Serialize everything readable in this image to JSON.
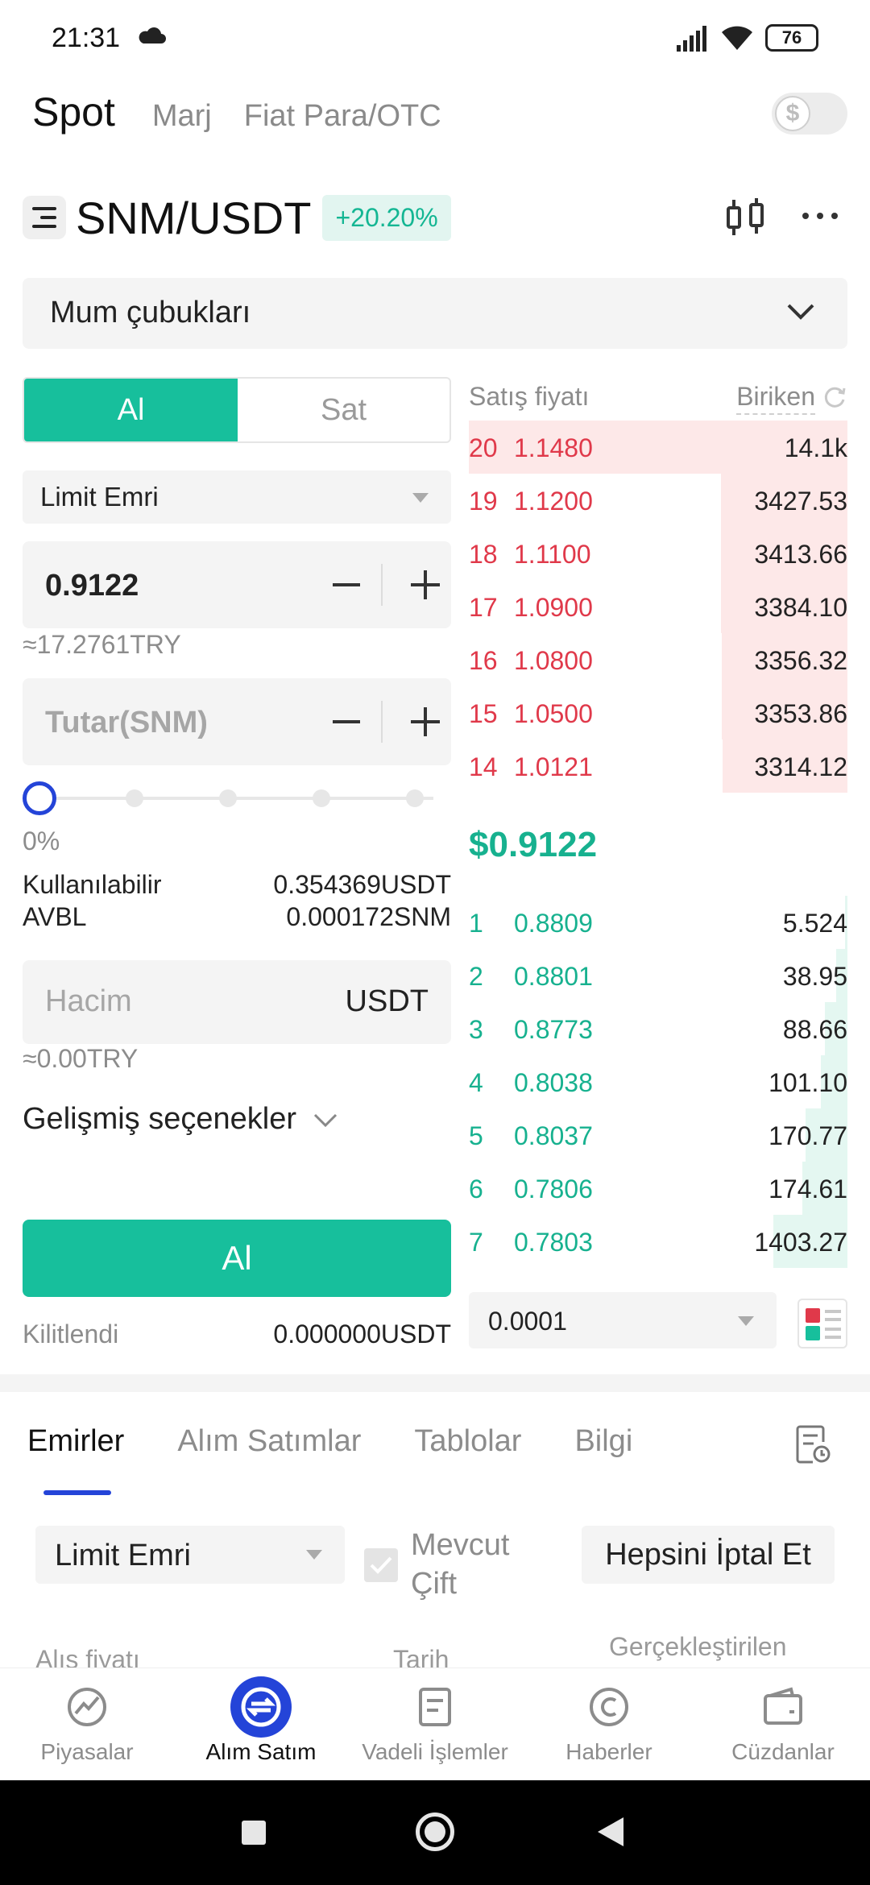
{
  "status_bar": {
    "time": "21:31",
    "battery": "76"
  },
  "top_tabs": {
    "spot": "Spot",
    "margin": "Marj",
    "fiat": "Fiat Para/OTC"
  },
  "pair": {
    "symbol": "SNM/USDT",
    "change": "+20.20%"
  },
  "chart_selector": {
    "label": "Mum çubukları"
  },
  "trade_form": {
    "buy_tab": "Al",
    "sell_tab": "Sat",
    "order_type": "Limit Emri",
    "price_value": "0.9122",
    "price_try": "≈17.2761TRY",
    "amount_placeholder": "Tutar(SNM)",
    "slider_percent": "0%",
    "available_label": "Kullanılabilir",
    "available_value": "0.354369USDT",
    "avbl_label": "AVBL",
    "avbl_value": "0.000172SNM",
    "volume_placeholder": "Hacim",
    "volume_unit": "USDT",
    "volume_try": "≈0.00TRY",
    "advanced_label": "Gelişmiş seçenekler",
    "buy_button": "Al",
    "locked_label": "Kilitlendi",
    "locked_value": "0.000000USDT"
  },
  "order_book": {
    "price_header": "Satış fiyatı",
    "cumulative_header": "Biriken",
    "last_price": "$0.9122",
    "precision": "0.0001",
    "asks": [
      {
        "level": "20",
        "price": "1.1480",
        "qty": "14.1k",
        "depth": 1.0
      },
      {
        "level": "19",
        "price": "1.1200",
        "qty": "3427.53",
        "depth": 0.335
      },
      {
        "level": "18",
        "price": "1.1100",
        "qty": "3413.66",
        "depth": 0.334
      },
      {
        "level": "17",
        "price": "1.0900",
        "qty": "3384.10",
        "depth": 0.333
      },
      {
        "level": "16",
        "price": "1.0800",
        "qty": "3356.32",
        "depth": 0.332
      },
      {
        "level": "15",
        "price": "1.0500",
        "qty": "3353.86",
        "depth": 0.331
      },
      {
        "level": "14",
        "price": "1.0121",
        "qty": "3314.12",
        "depth": 0.33
      }
    ],
    "bids": [
      {
        "level": "1",
        "price": "0.8809",
        "qty": "5.524",
        "depth": 0.006
      },
      {
        "level": "2",
        "price": "0.8801",
        "qty": "38.95",
        "depth": 0.03
      },
      {
        "level": "3",
        "price": "0.8773",
        "qty": "88.66",
        "depth": 0.06
      },
      {
        "level": "4",
        "price": "0.8038",
        "qty": "101.10",
        "depth": 0.07
      },
      {
        "level": "5",
        "price": "0.8037",
        "qty": "170.77",
        "depth": 0.11
      },
      {
        "level": "6",
        "price": "0.7806",
        "qty": "174.61",
        "depth": 0.12
      },
      {
        "level": "7",
        "price": "0.7803",
        "qty": "1403.27",
        "depth": 0.195
      }
    ]
  },
  "orders_section": {
    "tabs": [
      "Emirler",
      "Alım Satımlar",
      "Tablolar",
      "Bilgi"
    ],
    "filter_type": "Limit Emri",
    "current_pair_label": "Mevcut Çift",
    "cancel_all": "Hepsini İptal Et",
    "col_price": "Alış fiyatı",
    "col_date": "Tarih",
    "col_filled": "Gerçekleştirilen"
  },
  "bottom_nav": [
    {
      "label": "Piyasalar",
      "icon": "markets-icon"
    },
    {
      "label": "Alım Satım",
      "icon": "trade-icon"
    },
    {
      "label": "Vadeli İşlemler",
      "icon": "futures-icon"
    },
    {
      "label": "Haberler",
      "icon": "news-icon"
    },
    {
      "label": "Cüzdanlar",
      "icon": "wallet-icon"
    }
  ],
  "colors": {
    "buy": "#17bf9c",
    "sell": "#e0394a",
    "accent": "#2444d8"
  }
}
